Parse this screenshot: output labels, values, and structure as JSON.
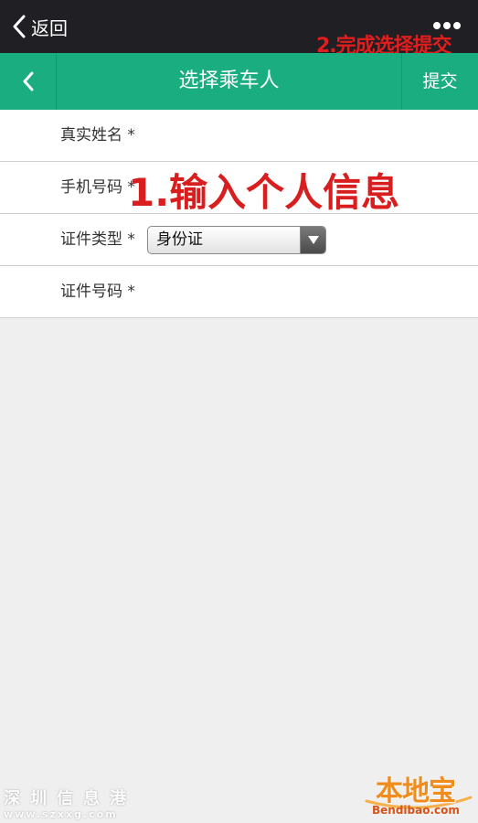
{
  "system_bar": {
    "back_label": "返回",
    "more_icon": "more-dots-icon"
  },
  "annotations": {
    "step_two": "2.完成选择提交",
    "step_one": "1.输入个人信息"
  },
  "nav": {
    "title": "选择乘车人",
    "submit_label": "提交",
    "back_icon": "chevron-left-icon"
  },
  "form": {
    "real_name_label": "真实姓名 *",
    "phone_label": "手机号码 *",
    "id_type_label": "证件类型 *",
    "id_type_value": "身份证",
    "id_number_label": "证件号码 *"
  },
  "watermarks": {
    "left_cn": "深圳信息港",
    "left_en": "www.szxxg.com",
    "right_cn": "本地宝",
    "right_en": "Bendibao.com"
  },
  "colors": {
    "accent": "#1aad7f",
    "system_bar": "#1f1f24",
    "annotation_red": "#e01e1e",
    "background": "#efefef"
  }
}
